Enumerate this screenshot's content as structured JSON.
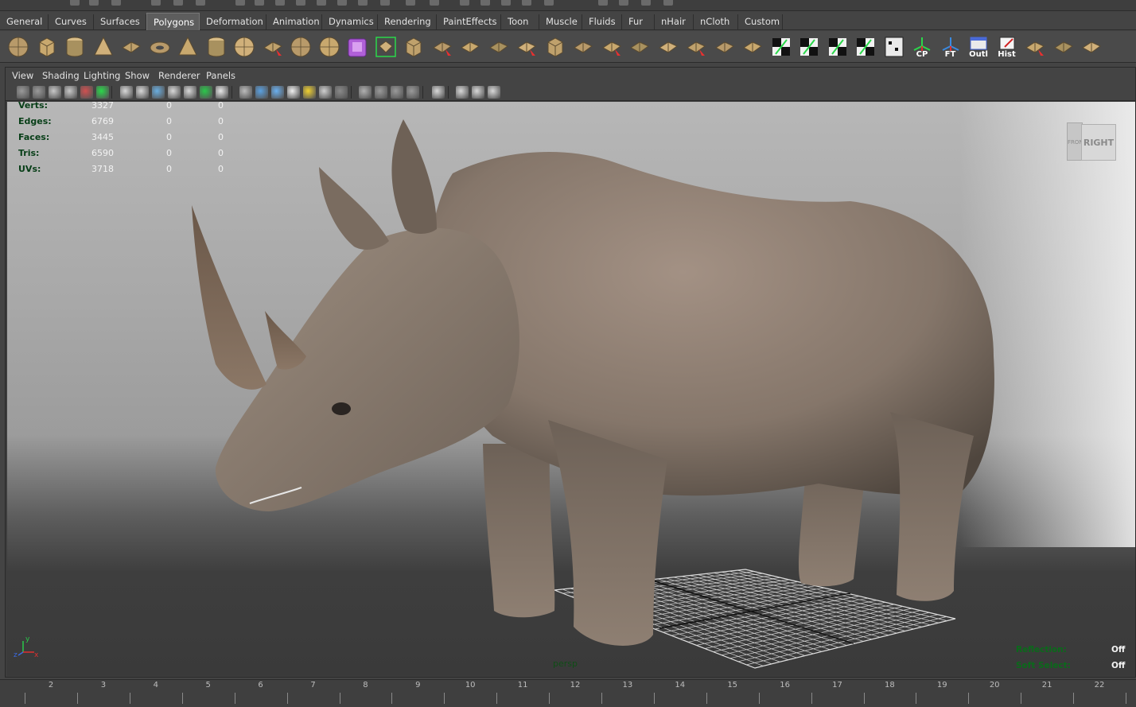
{
  "shelf_tabs": [
    "General",
    "Curves",
    "Surfaces",
    "Polygons",
    "Deformation",
    "Animation",
    "Dynamics",
    "Rendering",
    "PaintEffects",
    "Toon",
    "Muscle",
    "Fluids",
    "Fur",
    "nHair",
    "nCloth",
    "Custom"
  ],
  "active_tab": "Polygons",
  "shelf_icons": [
    {
      "name": "poly-sphere-icon"
    },
    {
      "name": "poly-cube-icon"
    },
    {
      "name": "poly-cylinder-icon"
    },
    {
      "name": "poly-cone-icon"
    },
    {
      "name": "poly-plane-icon"
    },
    {
      "name": "poly-torus-icon"
    },
    {
      "name": "poly-pyramid-icon"
    },
    {
      "name": "poly-pipe-icon"
    },
    {
      "name": "poly-helix-icon"
    },
    {
      "name": "extract-icon"
    },
    {
      "name": "combine-icon"
    },
    {
      "name": "separate-icon"
    },
    {
      "name": "smooth-proxy-icon"
    },
    {
      "name": "select-poly-icon"
    },
    {
      "name": "split-edge-icon"
    },
    {
      "name": "extrude-icon"
    },
    {
      "name": "bridge-icon"
    },
    {
      "name": "append-icon"
    },
    {
      "name": "fill-hole-icon"
    },
    {
      "name": "merge-icon"
    },
    {
      "name": "insert-edge-loop-icon"
    },
    {
      "name": "split-poly-icon"
    },
    {
      "name": "offset-edge-icon"
    },
    {
      "name": "wedge-icon"
    },
    {
      "name": "poke-icon"
    },
    {
      "name": "chamfer-icon"
    },
    {
      "name": "mirror-icon"
    },
    {
      "name": "uv-planar-icon"
    },
    {
      "name": "uv-cylindrical-icon"
    },
    {
      "name": "uv-spherical-icon"
    },
    {
      "name": "uv-automatic-icon"
    },
    {
      "name": "uv-editor-icon"
    },
    {
      "name": "center-pivot-icon",
      "label": "CP"
    },
    {
      "name": "freeze-transform-icon",
      "label": "FT"
    },
    {
      "name": "outliner-icon",
      "label": "Outl"
    },
    {
      "name": "history-icon",
      "label": "Hist"
    },
    {
      "name": "layout-uv-icon"
    },
    {
      "name": "selection-constraint-icon"
    },
    {
      "name": "ruler-icon"
    }
  ],
  "panel_menu": [
    "View",
    "Shading",
    "Lighting",
    "Show",
    "Renderer",
    "Panels"
  ],
  "hud_stats": [
    {
      "label": "Verts:",
      "v1": "3327",
      "v2": "0",
      "v3": "0"
    },
    {
      "label": "Edges:",
      "v1": "6769",
      "v2": "0",
      "v3": "0"
    },
    {
      "label": "Faces:",
      "v1": "3445",
      "v2": "0",
      "v3": "0"
    },
    {
      "label": "Tris:",
      "v1": "6590",
      "v2": "0",
      "v3": "0"
    },
    {
      "label": "UVs:",
      "v1": "3718",
      "v2": "0",
      "v3": "0"
    }
  ],
  "view_cube": {
    "front": "FRONT",
    "right": "RIGHT"
  },
  "camera_label": "persp",
  "hud_right": {
    "reflection_label": "Reflection:",
    "reflection_value": "Off",
    "soft_select_label": "Soft Select:",
    "soft_select_value": "Off"
  },
  "axis": {
    "x": "x",
    "y": "y",
    "z": "z"
  },
  "time_ticks": [
    "2",
    "3",
    "4",
    "5",
    "6",
    "7",
    "8",
    "9",
    "10",
    "11",
    "12",
    "13",
    "14",
    "15",
    "16",
    "17",
    "18",
    "19",
    "20",
    "21",
    "22"
  ],
  "colors": {
    "hud_green": "#073e17",
    "skin": "#8a7a6c",
    "accent": "#00aaff"
  }
}
